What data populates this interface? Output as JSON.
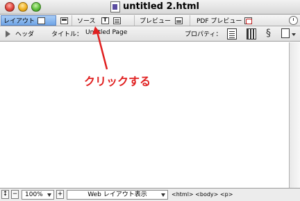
{
  "window": {
    "title": "untitled 2.html"
  },
  "view_tabs": {
    "layout": "レイアウト",
    "source": "ソース",
    "preview": "プレビュー",
    "pdf_preview": "PDF プレビュー"
  },
  "header_bar": {
    "header_label": "ヘッダ",
    "title_label": "タイトル：",
    "title_value": "Untitled Page",
    "properties_label": "プロパティ："
  },
  "annotation": {
    "text": "クリックする",
    "color": "#e02020"
  },
  "status": {
    "zoom": "100%",
    "view_mode": "Web レイアウト表示",
    "tags": "<html>  <body>  <p>"
  }
}
